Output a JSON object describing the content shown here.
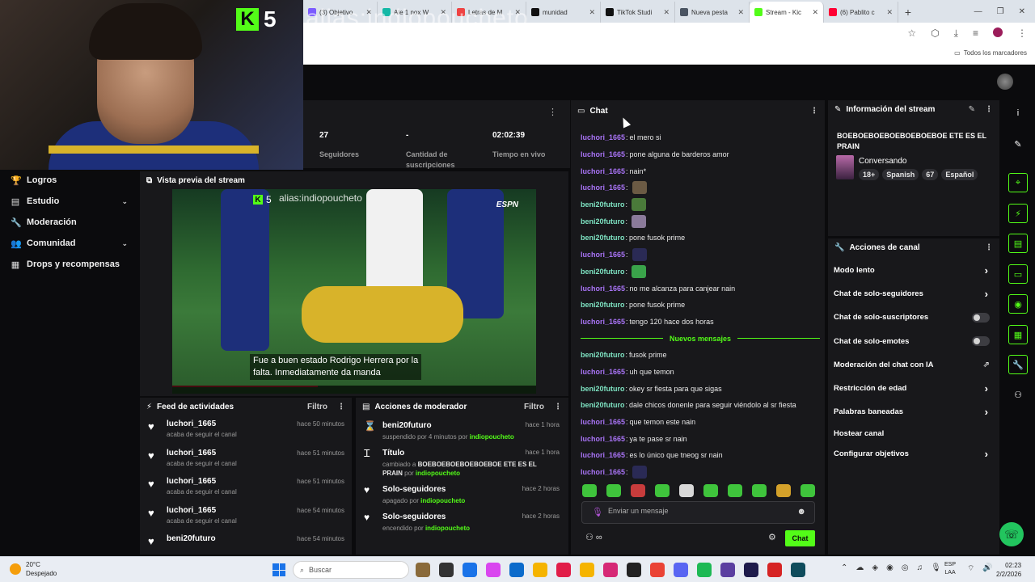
{
  "webcam": {
    "badge_number": "5"
  },
  "browser": {
    "tabs": [
      {
        "label": "(3) Objetivo",
        "color": "#7c5cff"
      },
      {
        "label": "Ale 1 nox W",
        "color": "#14b8a6"
      },
      {
        "label": "Letras de M",
        "color": "#ef4444"
      },
      {
        "label": "munidad",
        "color": "#111111"
      },
      {
        "label": "TikTok Studi",
        "color": "#111111"
      },
      {
        "label": "Nueva pesta",
        "color": "#4b5563"
      },
      {
        "label": "Stream - Kic",
        "color": "#53fc18"
      },
      {
        "label": "(6) Pablito c",
        "color": "#ff0033"
      }
    ],
    "active_tab": 6,
    "watermark": "alias:indiopoucheto",
    "bookmarks_label": "Todos los marcadores"
  },
  "sidebar": {
    "items": [
      {
        "label": "Logros",
        "icon": "trophy-icon",
        "glyph": "🏆",
        "expandable": false
      },
      {
        "label": "Estudio",
        "icon": "studio-icon",
        "glyph": "▤",
        "expandable": true
      },
      {
        "label": "Moderación",
        "icon": "wrench-icon",
        "glyph": "🔧",
        "expandable": false
      },
      {
        "label": "Comunidad",
        "icon": "community-icon",
        "glyph": "👥",
        "expandable": true
      },
      {
        "label": "Drops y recompensas",
        "icon": "gift-icon",
        "glyph": "▦",
        "expandable": false
      }
    ]
  },
  "stats": {
    "items": [
      {
        "value": "27",
        "label": "Seguidores"
      },
      {
        "value": "-",
        "label": "Cantidad de suscripciones"
      },
      {
        "value": "02:02:39",
        "label": "Tiempo en vivo"
      }
    ]
  },
  "preview": {
    "title": "Vista previa del stream",
    "video_badge_number": "5",
    "video_watermark": "alias:indiopoucheto",
    "video_logo": "ESPN",
    "subtitle_line1": "Fue a buen estado Rodrigo Herrera por la",
    "subtitle_line2": "falta. Inmediatamente da manda"
  },
  "feed": {
    "title": "Feed de actividades",
    "filter": "Filtro",
    "items": [
      {
        "user": "luchori_1665",
        "action": "acaba de seguir el canal",
        "time": "hace 50 minutos"
      },
      {
        "user": "luchori_1665",
        "action": "acaba de seguir el canal",
        "time": "hace 51 minutos"
      },
      {
        "user": "luchori_1665",
        "action": "acaba de seguir el canal",
        "time": "hace 51 minutos"
      },
      {
        "user": "luchori_1665",
        "action": "acaba de seguir el canal",
        "time": "hace 54 minutos"
      },
      {
        "user": "beni20futuro",
        "action": "",
        "time": "hace 54 minutos"
      }
    ]
  },
  "modactions": {
    "title": "Acciones de moderador",
    "filter": "Filtro",
    "items": [
      {
        "icon": "hourglass-icon",
        "glyph": "⌛",
        "title": "beni20futuro",
        "time": "hace 1 hora",
        "pre": "suspendido por 4 minutos por ",
        "bold": "",
        "mid": "",
        "mod": "indiopoucheto"
      },
      {
        "icon": "title-icon",
        "glyph": "Ꮖ",
        "title": "Título",
        "time": "hace 1 hora",
        "pre": "cambiado a ",
        "bold": "BOEBOEBOEBOEBOEBOE ETE ES EL PRAIN",
        "mid": " por ",
        "mod": "indiopoucheto"
      },
      {
        "icon": "heart-icon",
        "glyph": "♥",
        "title": "Solo-seguidores",
        "time": "hace 2 horas",
        "pre": "apagado por ",
        "bold": "",
        "mid": "",
        "mod": "indiopoucheto"
      },
      {
        "icon": "heart-icon",
        "glyph": "♥",
        "title": "Solo-seguidores",
        "time": "hace 2 horas",
        "pre": "encendido por ",
        "bold": "",
        "mid": "",
        "mod": "indiopoucheto"
      }
    ]
  },
  "chat": {
    "title": "Chat",
    "new_messages_label": "Nuevos mensajes",
    "divider_index": 12,
    "user_colors": {
      "luchori_1665": "#a873f5",
      "beni20futuro": "#7ee3c2"
    },
    "messages": [
      {
        "user": "luchori_1665",
        "text": "el mero si",
        "emote": ""
      },
      {
        "user": "luchori_1665",
        "text": "pone alguna de barderos amor",
        "emote": ""
      },
      {
        "user": "luchori_1665",
        "text": "nain*",
        "emote": ""
      },
      {
        "user": "luchori_1665",
        "text": "",
        "emote": "#6b5a44"
      },
      {
        "user": "beni20futuro",
        "text": "",
        "emote": "#4a7a3a"
      },
      {
        "user": "beni20futuro",
        "text": "",
        "emote": "#8a7a9a"
      },
      {
        "user": "beni20futuro",
        "text": "pone fusok prime",
        "emote": ""
      },
      {
        "user": "luchori_1665",
        "text": "",
        "emote": "#2a2a55"
      },
      {
        "user": "beni20futuro",
        "text": "",
        "emote": "#3aa34a"
      },
      {
        "user": "luchori_1665",
        "text": "no me alcanza para canjear nain",
        "emote": ""
      },
      {
        "user": "beni20futuro",
        "text": "pone fusok prime",
        "emote": ""
      },
      {
        "user": "luchori_1665",
        "text": "tengo 120 hace dos horas",
        "emote": ""
      },
      {
        "user": "beni20futuro",
        "text": "fusok prime",
        "emote": ""
      },
      {
        "user": "luchori_1665",
        "text": "uh que temon",
        "emote": ""
      },
      {
        "user": "beni20futuro",
        "text": "okey sr fiesta para que sigas",
        "emote": ""
      },
      {
        "user": "beni20futuro",
        "text": "dale chicos donenle para seguir viéndolo al sr fiesta",
        "emote": ""
      },
      {
        "user": "luchori_1665",
        "text": "que temon este nain",
        "emote": ""
      },
      {
        "user": "luchori_1665",
        "text": "ya te pase sr nain",
        "emote": ""
      },
      {
        "user": "luchori_1665",
        "text": "es lo único que tneog sr nain",
        "emote": ""
      },
      {
        "user": "luchori_1665",
        "text": "",
        "emote": "#2a2a55"
      }
    ],
    "input_placeholder": "Enviar un mensaje",
    "send_label": "Chat",
    "emote_colors": [
      "#3fc43c",
      "#3fc43c",
      "#c83c3c",
      "#3fc43c",
      "#d8d8d8",
      "#3fc43c",
      "#3fc43c",
      "#3fc43c",
      "#d4a12a",
      "#3fc43c"
    ]
  },
  "stream_info": {
    "title": "Información del stream",
    "stream_title": "BOEBOEBOEBOEBOEBOEBOE ETE ES EL PRAIN",
    "category": "Conversando",
    "tags": [
      "18+",
      "Spanish",
      "67",
      "Español"
    ]
  },
  "channel_actions": {
    "title": "Acciones de canal",
    "items": [
      {
        "label": "Modo lento",
        "control": "chevron"
      },
      {
        "label": "Chat de solo-seguidores",
        "control": "chevron"
      },
      {
        "label": "Chat de solo-suscriptores",
        "control": "toggle"
      },
      {
        "label": "Chat de solo-emotes",
        "control": "toggle"
      },
      {
        "label": "Moderación del chat con IA",
        "control": "external"
      },
      {
        "label": "Restricción de edad",
        "control": "chevron"
      },
      {
        "label": "Palabras baneadas",
        "control": "chevron"
      },
      {
        "label": "Hostear canal",
        "control": "none"
      },
      {
        "label": "Configurar objetivos",
        "control": "chevron"
      }
    ]
  },
  "taskbar": {
    "temperature": "20°C",
    "weather": "Despejado",
    "search_placeholder": "Buscar",
    "lang_line1": "ESP",
    "lang_line2": "LAA",
    "time": "02:23",
    "date": "2/2/2026",
    "icon_colors": [
      "#8a6a3a",
      "#333333",
      "#1a73e8",
      "#d946ef",
      "#0b6bcb",
      "#f5b400",
      "#e11d48",
      "#f5b400",
      "#d62976",
      "#222222",
      "#ea4335",
      "#5865f2",
      "#1db954",
      "#5b3fa0",
      "#1e1b4b",
      "#d62424",
      "#0f4c5c"
    ]
  },
  "rail": {
    "icons": [
      {
        "name": "info-icon",
        "glyph": "i",
        "boxed": false
      },
      {
        "name": "edit-icon",
        "glyph": "✎",
        "boxed": false
      },
      {
        "name": "target-icon",
        "glyph": "⌖",
        "boxed": true
      },
      {
        "name": "bolt-icon",
        "glyph": "⚡",
        "boxed": true
      },
      {
        "name": "notes-icon",
        "glyph": "▤",
        "boxed": true
      },
      {
        "name": "chat-icon",
        "glyph": "▭",
        "boxed": true
      },
      {
        "name": "broadcast-icon",
        "glyph": "◉",
        "boxed": true
      },
      {
        "name": "layout-icon",
        "glyph": "▦",
        "boxed": true
      },
      {
        "name": "wrench-icon",
        "glyph": "🔧",
        "boxed": true
      },
      {
        "name": "users-icon",
        "glyph": "⚇",
        "boxed": false
      }
    ]
  }
}
